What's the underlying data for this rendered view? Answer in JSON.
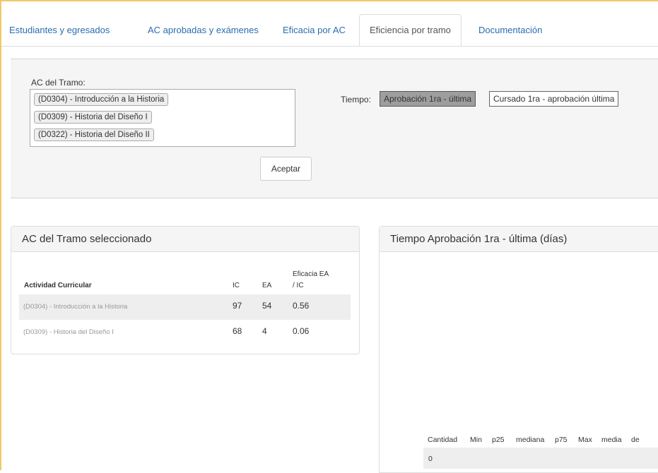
{
  "tabs": [
    {
      "label": "Estudiantes y egresados",
      "active": false
    },
    {
      "label": "AC aprobadas y exámenes",
      "active": false
    },
    {
      "label": "Eficacia por AC",
      "active": false
    },
    {
      "label": "Eficiencia por tramo",
      "active": true
    },
    {
      "label": "Documentación",
      "active": false
    }
  ],
  "filter": {
    "ac_label": "AC del Tramo:",
    "selected": [
      "(D0304) - Introducción a la Historia",
      "(D0309) - Historia del Diseño I",
      "(D0322) - Historia del Diseño II"
    ],
    "accept_label": "Aceptar",
    "tiempo_label": "Tiempo:",
    "tiempo_options": [
      "Aprobación 1ra - última",
      "Cursado 1ra - aprobación última"
    ],
    "tiempo_selected": "Aprobación 1ra - última"
  },
  "ac_box": {
    "title": "AC del Tramo seleccionado",
    "headers": {
      "name": "Actividad Curricular",
      "ic": "IC",
      "ea": "EA",
      "eff_line1": "Eficacia EA",
      "eff_line2": "/ IC"
    },
    "rows": [
      {
        "name": "(D0304) - Introducción a la Historia",
        "ic": "97",
        "ea": "54",
        "eff": "0.56"
      },
      {
        "name": "(D0309) - Historia del Diseño I",
        "ic": "68",
        "ea": "4",
        "eff": "0.06"
      }
    ]
  },
  "tiempo_box": {
    "title": "Tiempo Aprobación 1ra - última (días)",
    "headers": [
      "Cantidad",
      "Min",
      "p25",
      "mediana",
      "p75",
      "Max",
      "media",
      "de"
    ],
    "values": [
      "0"
    ]
  },
  "colors": {
    "accent_border": "#f4c76b",
    "link": "#2a6db0",
    "selected_button": "#9e9e9e"
  }
}
